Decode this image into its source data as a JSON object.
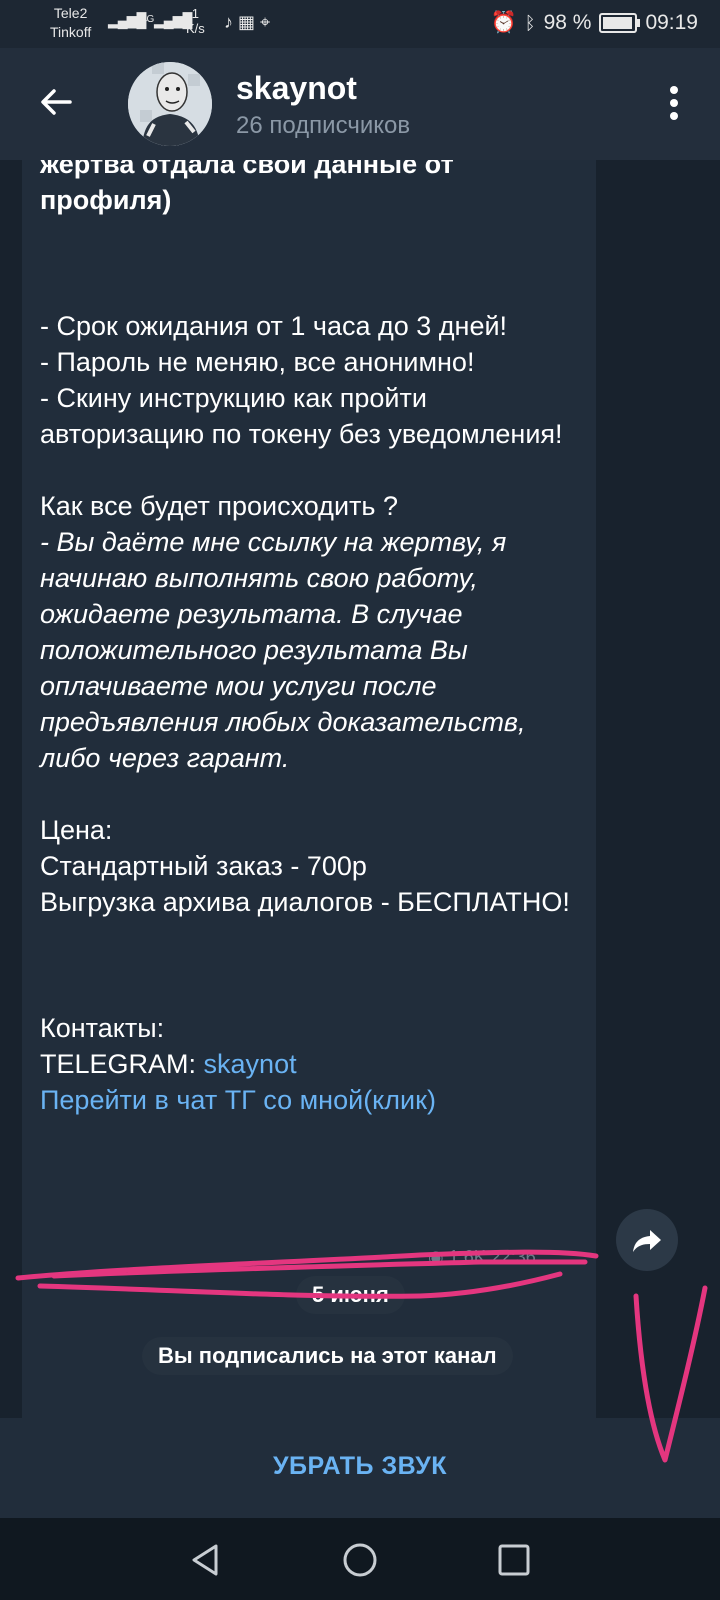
{
  "status_bar": {
    "carrier1": "Tele2",
    "carrier2": "Tinkoff",
    "signal1": "4G",
    "speed_value": "1",
    "speed_unit": "K/s",
    "battery": "98 %",
    "time": "09:19"
  },
  "header": {
    "channel_name": "skaynot",
    "subscribers": "26 подписчиков"
  },
  "message": {
    "lines_bold": [
      "жертва отдала свои данные от",
      "профиля)"
    ],
    "list_1": "- Срок ожидания от 1 часа до 3 дней!",
    "list_2": "- Пароль не меняю, все анонимно!",
    "list_3": "- Скину инструкцию как пройти авторизацию по токену без уведомления!",
    "how_title": "Как все будет происходить ?",
    "how_text": "- Вы даёте мне ссылку на жертву, я начинаю выполнять свою работу, ожидаете результата. В случае положительного результата Вы оплачиваете мои услуги после предъявления любых доказательств, либо через гарант.",
    "price_label": "Цена:",
    "price_standard": "Стандартный заказ - 700р",
    "price_archive": "Выгрузка архива диалогов - БЕСПЛАТНО!",
    "contacts_label": "Контакты:",
    "telegram_label": "TELEGRAM: ",
    "telegram_handle": "skaynot",
    "chat_link": "Перейти в чат ТГ со мной(клик)",
    "meta": "1.6K  22:36"
  },
  "date_pill": "5 июня",
  "service_pill": "Вы подписались на этот канал",
  "mute_button": "УБРАТЬ ЗВУК",
  "colors": {
    "link": "#6ab3f3",
    "bubble": "#212d3b",
    "background": "#18222d",
    "scribble": "#e4367f"
  }
}
